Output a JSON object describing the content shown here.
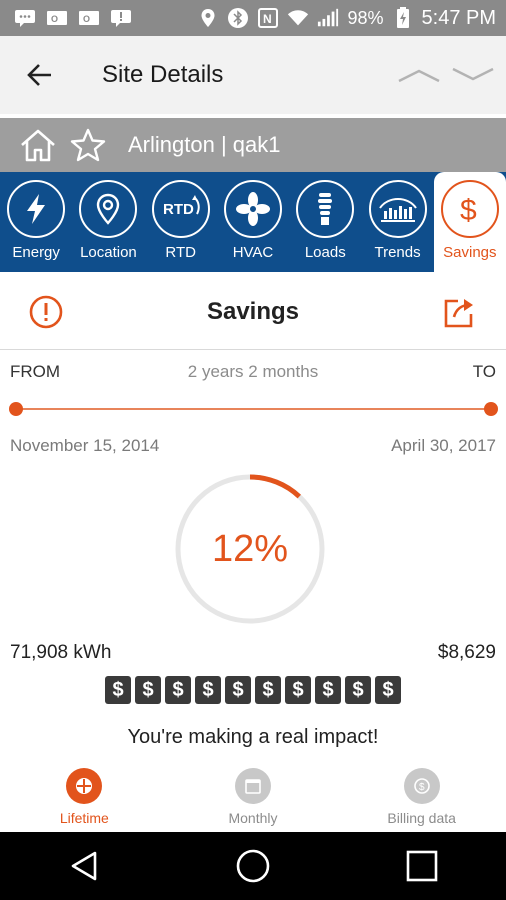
{
  "status_bar": {
    "battery": "98%",
    "time": "5:47 PM"
  },
  "app_bar": {
    "title": "Site Details"
  },
  "site": {
    "name": "Arlington | qak1"
  },
  "tabs": [
    {
      "label": "Energy",
      "icon": "lightning-icon"
    },
    {
      "label": "Location",
      "icon": "location-pin-icon"
    },
    {
      "label": "RTD",
      "icon": "rtd-icon"
    },
    {
      "label": "HVAC",
      "icon": "fan-icon"
    },
    {
      "label": "Loads",
      "icon": "bulb-icon"
    },
    {
      "label": "Trends",
      "icon": "trends-icon"
    },
    {
      "label": "Savings",
      "icon": "dollar-icon",
      "active": true
    }
  ],
  "savings": {
    "title": "Savings",
    "from_label": "FROM",
    "to_label": "TO",
    "duration": "2 years 2 months",
    "start_date": "November 15, 2014",
    "end_date": "April 30, 2017",
    "percent_text": "12%",
    "percent_value": 0.12,
    "energy": "71,908 kWh",
    "money": "$8,629",
    "dollar_symbols": [
      "$",
      "$",
      "$",
      "$",
      "$",
      "$",
      "$",
      "$",
      "$",
      "$"
    ],
    "message": "You're making a real impact!"
  },
  "bottom_tabs": [
    {
      "label": "Lifetime",
      "active": true
    },
    {
      "label": "Monthly",
      "active": false
    },
    {
      "label": "Billing data",
      "active": false
    }
  ],
  "colors": {
    "accent": "#e2541c",
    "tab_bar": "#0f4e8c",
    "site_bar": "#9e9e9e"
  }
}
